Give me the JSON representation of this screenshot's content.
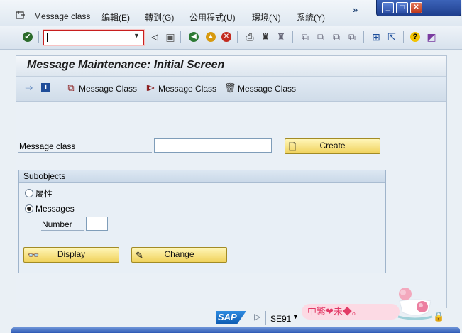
{
  "menubar": {
    "items": [
      {
        "label": "Message class"
      },
      {
        "label": "編輯(E)"
      },
      {
        "label": "轉到(G)"
      },
      {
        "label": "公用程式(U)"
      },
      {
        "label": "環境(N)"
      },
      {
        "label": "系統(Y)"
      }
    ],
    "overflow": "»"
  },
  "window": {
    "minimize": "_",
    "maximize": "□",
    "close": "✕"
  },
  "toolbar": {
    "command_value": ""
  },
  "screen": {
    "title": "Message Maintenance: Initial Screen"
  },
  "app_toolbar": {
    "copy_label": "Message Class",
    "rename_label": "Message Class",
    "delete_label": "Message Class"
  },
  "form": {
    "message_class_label": "Message class",
    "message_class_value": "",
    "create_label": "Create"
  },
  "subobjects": {
    "title": "Subobjects",
    "options": [
      {
        "label": "屬性",
        "selected": false
      },
      {
        "label": "Messages",
        "selected": true
      }
    ],
    "number_label": "Number",
    "number_value": "",
    "display_label": "Display",
    "change_label": "Change"
  },
  "statusbar": {
    "logo": "SAP",
    "system_id": "SE91",
    "watermark": "中繁❤未◆。"
  },
  "colors": {
    "button_yellow": "#f0d25c",
    "header_blue": "#1f3f8e",
    "command_border": "#c81e1e"
  }
}
